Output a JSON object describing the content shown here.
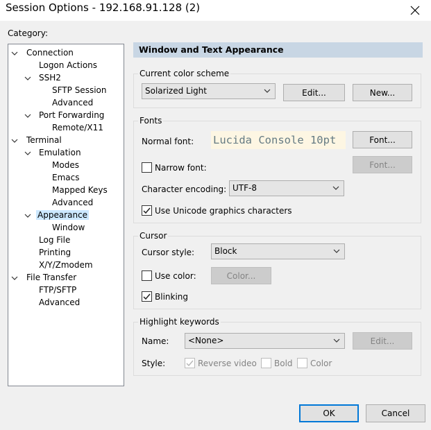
{
  "window": {
    "title": "Session Options - 192.168.91.128 (2)"
  },
  "category_label": "Category:",
  "tree": [
    {
      "label": "Connection",
      "expanded": true
    },
    {
      "label": "Logon Actions"
    },
    {
      "label": "SSH2",
      "expanded": true
    },
    {
      "label": "SFTP Session"
    },
    {
      "label": "Advanced"
    },
    {
      "label": "Port Forwarding",
      "expanded": true
    },
    {
      "label": "Remote/X11"
    },
    {
      "label": "Terminal",
      "expanded": true
    },
    {
      "label": "Emulation",
      "expanded": true
    },
    {
      "label": "Modes"
    },
    {
      "label": "Emacs"
    },
    {
      "label": "Mapped Keys"
    },
    {
      "label": "Advanced"
    },
    {
      "label": "Appearance",
      "expanded": true,
      "selected": true
    },
    {
      "label": "Window"
    },
    {
      "label": "Log File"
    },
    {
      "label": "Printing"
    },
    {
      "label": "X/Y/Zmodem"
    },
    {
      "label": "File Transfer",
      "expanded": true
    },
    {
      "label": "FTP/SFTP"
    },
    {
      "label": "Advanced"
    }
  ],
  "panel": {
    "header": "Window and Text Appearance",
    "color_scheme": {
      "group_title": "Current color scheme",
      "selected": "Solarized Light",
      "edit_label": "Edit...",
      "new_label": "New..."
    },
    "fonts": {
      "group_title": "Fonts",
      "normal_font_label": "Normal font:",
      "normal_font_preview": "Lucida Console 10pt",
      "font_button": "Font...",
      "narrow_font_label": "Narrow font:",
      "narrow_font_checked": false,
      "narrow_font_button": "Font...",
      "encoding_label": "Character encoding:",
      "encoding_value": "UTF-8",
      "unicode_label": "Use Unicode graphics characters",
      "unicode_checked": true
    },
    "cursor": {
      "group_title": "Cursor",
      "style_label": "Cursor style:",
      "style_value": "Block",
      "use_color_label": "Use color:",
      "use_color_checked": false,
      "color_button": "Color...",
      "blinking_label": "Blinking",
      "blinking_checked": true
    },
    "highlight": {
      "group_title": "Highlight keywords",
      "name_label": "Name:",
      "name_value": "<None>",
      "edit_label": "Edit...",
      "style_label": "Style:",
      "reverse_video_label": "Reverse video",
      "reverse_video_checked": true,
      "bold_label": "Bold",
      "bold_checked": false,
      "color_label": "Color",
      "color_checked": false
    }
  },
  "buttons": {
    "ok": "OK",
    "cancel": "Cancel"
  },
  "colors": {
    "selection": "#cce8ff",
    "header_bg": "#c8d6e4",
    "preview_bg": "#fdf6e3",
    "preview_fg": "#657b83",
    "default_button_border": "#0078d7"
  }
}
